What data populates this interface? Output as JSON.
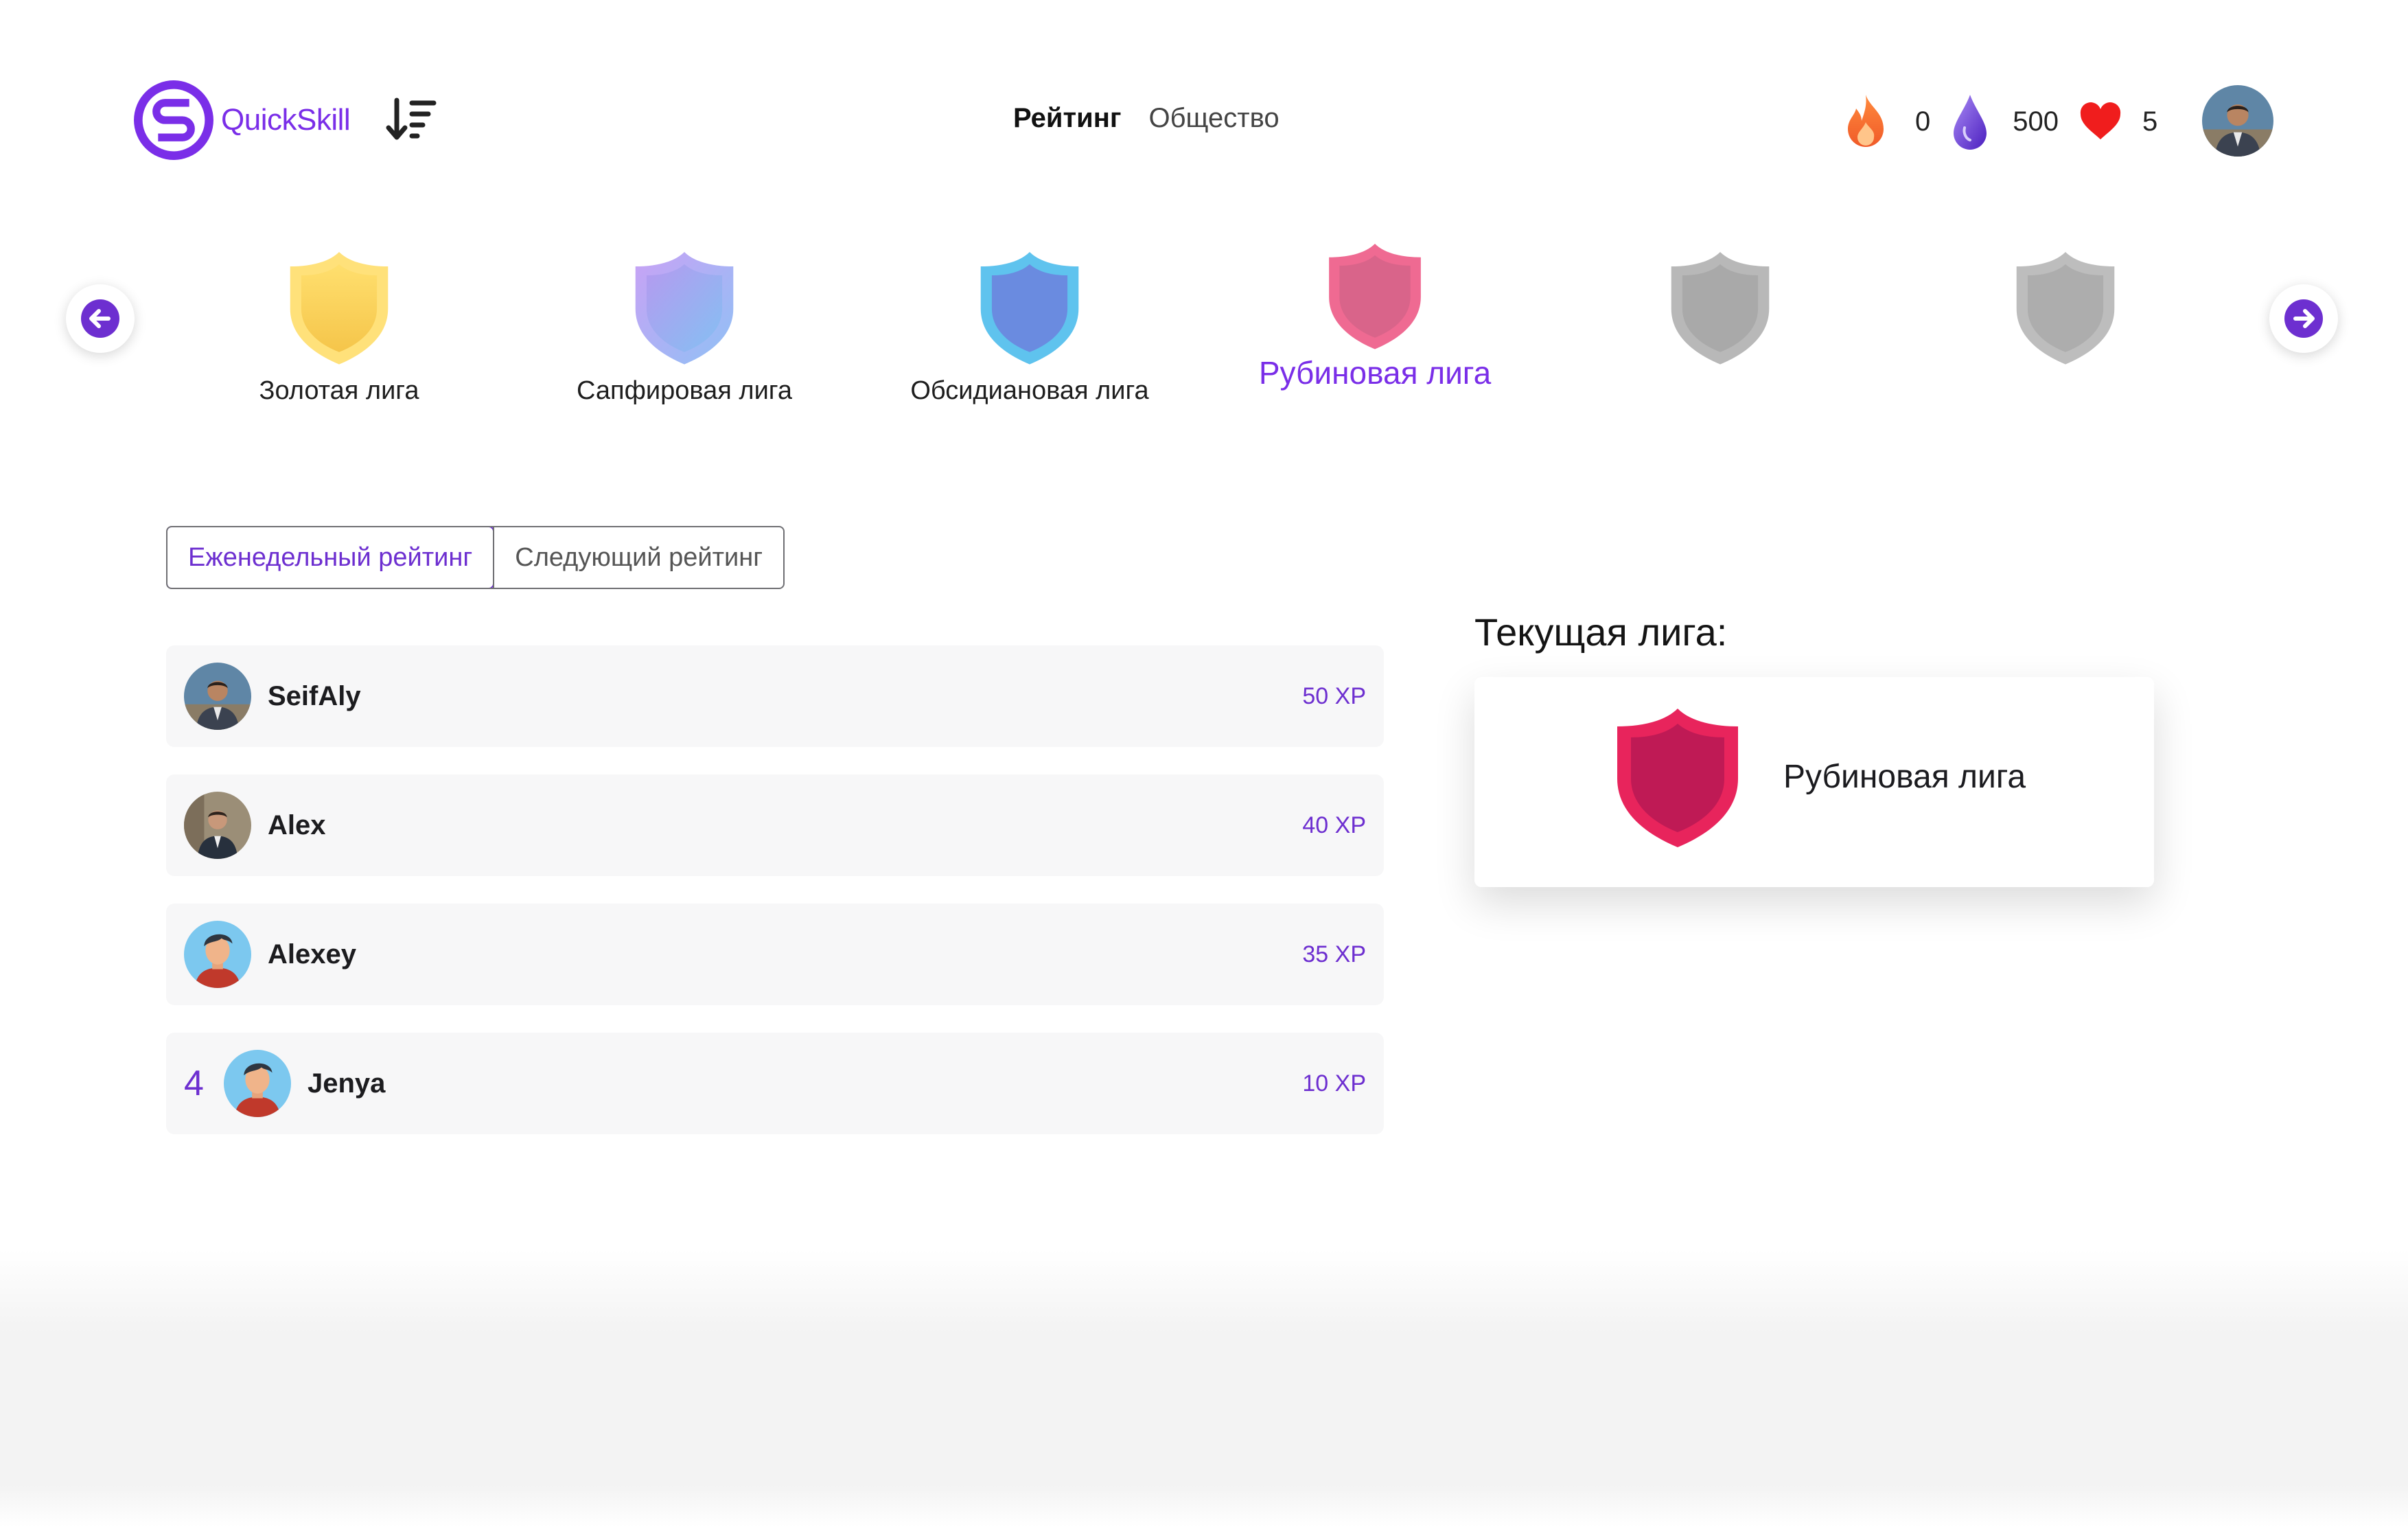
{
  "header": {
    "logo_text": "QuickSkill",
    "nav": {
      "active": "Рейтинг",
      "inactive": "Общество"
    },
    "stats": {
      "streak": "0",
      "gems": "500",
      "lives": "5"
    }
  },
  "leagues": [
    {
      "name": "Золотая лига",
      "state": "unlocked"
    },
    {
      "name": "Сапфировая лига",
      "state": "unlocked"
    },
    {
      "name": "Обсидиановая лига",
      "state": "unlocked"
    },
    {
      "name": "Рубиновая лига",
      "state": "current"
    },
    {
      "name": "",
      "state": "locked"
    },
    {
      "name": "",
      "state": "locked"
    }
  ],
  "tabs": {
    "weekly": "Еженедельный рейтинг",
    "next": "Следующий рейтинг"
  },
  "leaderboard": [
    {
      "rank": "",
      "name": "SeifAly",
      "xp": "50 XP"
    },
    {
      "rank": "",
      "name": "Alex",
      "xp": "40 XP"
    },
    {
      "rank": "",
      "name": "Alexey",
      "xp": "35 XP"
    },
    {
      "rank": "4",
      "name": "Jenya",
      "xp": "10 XP"
    }
  ],
  "current_league": {
    "title": "Текущая лига:",
    "name": "Рубиновая лига"
  },
  "colors": {
    "accent": "#6d2fd0",
    "brand": "#7a2ee8",
    "ruby": "#e8245c"
  }
}
